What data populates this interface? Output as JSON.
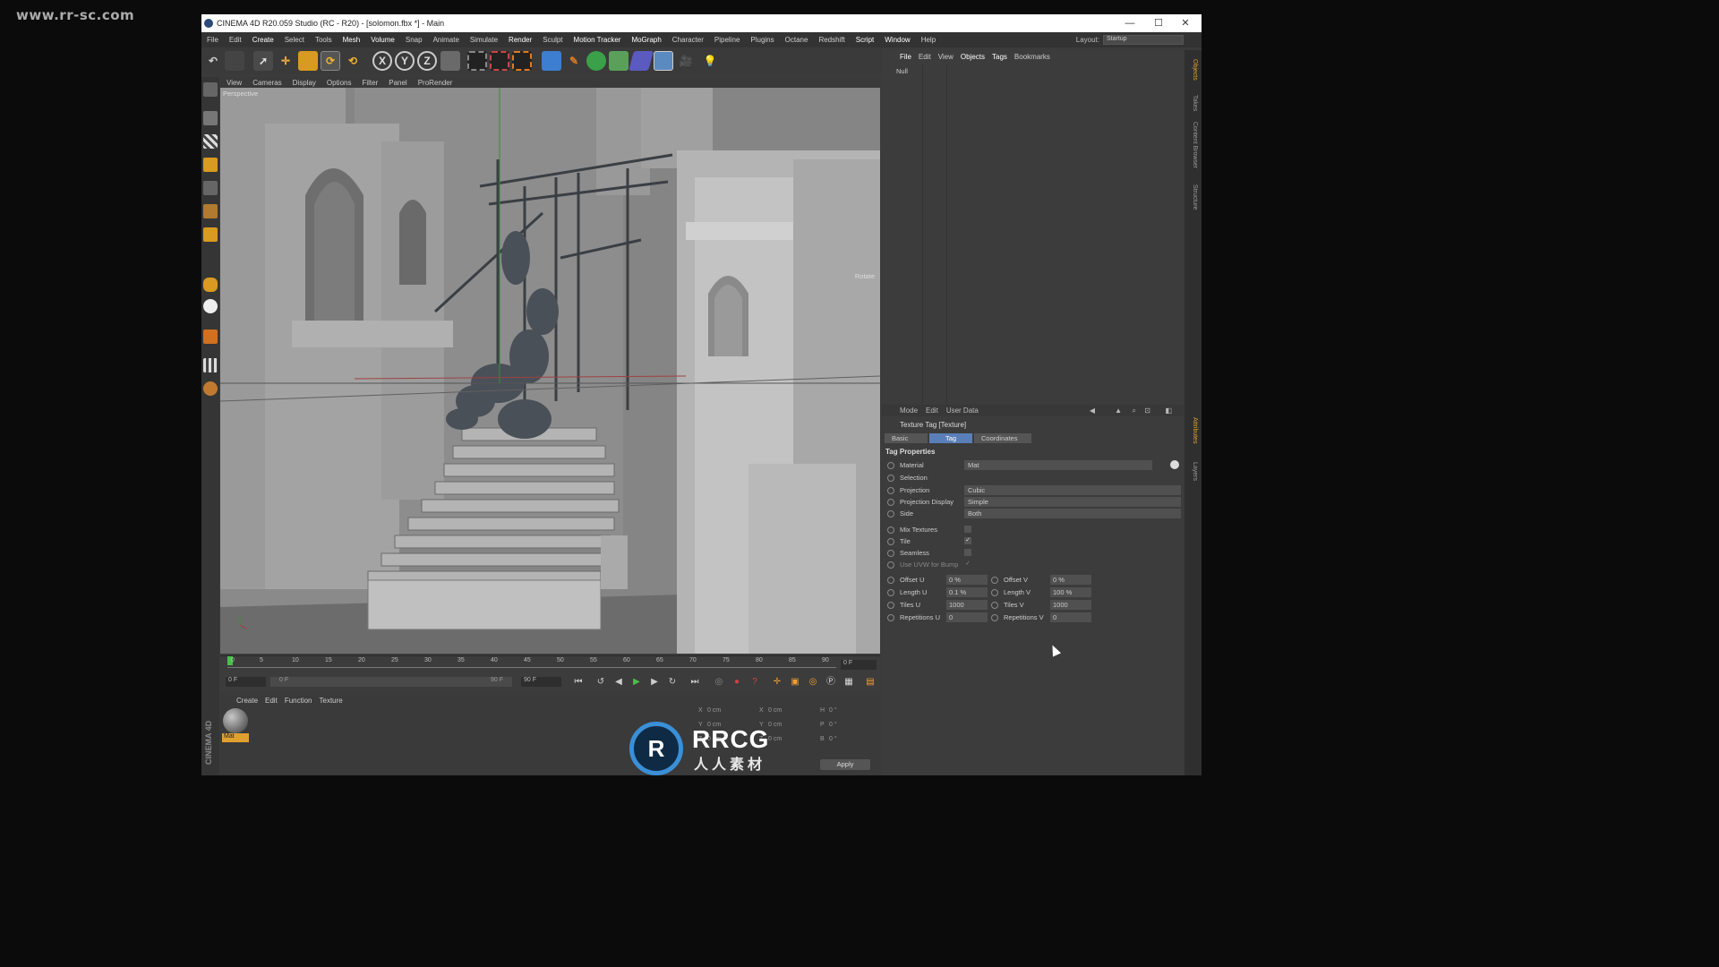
{
  "watermark_top": "www.rr-sc.com",
  "window": {
    "title": "CINEMA 4D R20.059 Studio (RC - R20) - [solomon.fbx *] - Main",
    "minimize": "—",
    "maximize": "☐",
    "close": "✕"
  },
  "menu": [
    "File",
    "Edit",
    "Create",
    "Select",
    "Tools",
    "Mesh",
    "Volume",
    "Snap",
    "Animate",
    "Simulate",
    "Render",
    "Sculpt",
    "Motion Tracker",
    "MoGraph",
    "Character",
    "Pipeline",
    "Plugins",
    "Octane",
    "Redshift",
    "Script",
    "Window",
    "Help"
  ],
  "layout": {
    "label": "Layout:",
    "value": "Startup"
  },
  "toolbar": {
    "x": "X",
    "y": "Y",
    "z": "Z"
  },
  "viewport": {
    "menu": [
      "View",
      "Cameras",
      "Display",
      "Options",
      "Filter",
      "Panel",
      "ProRender"
    ],
    "label": "Perspective",
    "rotate": "Rotate"
  },
  "timeline": {
    "ticks": [
      "0",
      "5",
      "10",
      "15",
      "20",
      "25",
      "30",
      "35",
      "40",
      "45",
      "50",
      "55",
      "60",
      "65",
      "70",
      "75",
      "80",
      "85",
      "90"
    ],
    "frame": "0 F"
  },
  "playbar": {
    "start": "0 F",
    "min": "0 F",
    "max": "90 F",
    "end": "90 F"
  },
  "material_manager": {
    "menu": [
      "Create",
      "Edit",
      "Function",
      "Texture"
    ],
    "material_name": "Mat"
  },
  "brand_vertical": "CINEMA 4D",
  "coords": {
    "rows": [
      {
        "a": "X",
        "av": "0 cm",
        "b": "X",
        "bv": "0 cm",
        "c": "H",
        "cv": "0 °"
      },
      {
        "a": "Y",
        "av": "0 cm",
        "b": "Y",
        "bv": "0 cm",
        "c": "P",
        "cv": "0 °"
      },
      {
        "a": "Z",
        "av": "0 cm",
        "b": "Z",
        "bv": "0 cm",
        "c": "B",
        "cv": "0 °"
      }
    ],
    "apply": "Apply"
  },
  "object_manager": {
    "menu": [
      "File",
      "Edit",
      "View",
      "Objects",
      "Tags",
      "Bookmarks"
    ],
    "object": "Null"
  },
  "attributes": {
    "menu": [
      "Mode",
      "Edit",
      "User Data"
    ],
    "title": "Texture Tag [Texture]",
    "tabs": [
      "Basic",
      "Tag",
      "Coordinates"
    ],
    "section": "Tag Properties",
    "props": [
      {
        "label": "Material",
        "value": "Mat"
      },
      {
        "label": "Selection",
        "value": ""
      },
      {
        "label": "Projection",
        "value": "Cubic"
      },
      {
        "label": "Projection Display",
        "value": "Simple"
      },
      {
        "label": "Side",
        "value": "Both"
      }
    ],
    "checks": [
      {
        "label": "Mix Textures",
        "value": ""
      },
      {
        "label": "Tile",
        "value": "✓"
      },
      {
        "label": "Seamless",
        "value": ""
      },
      {
        "label": "Use UVW for Bump",
        "value": "✓"
      }
    ],
    "numeric": [
      {
        "l1": "Offset U",
        "v1": "0 %",
        "l2": "Offset V",
        "v2": "0 %"
      },
      {
        "l1": "Length U",
        "v1": "0.1 %",
        "l2": "Length V",
        "v2": "100 %"
      },
      {
        "l1": "Tiles U",
        "v1": "1000",
        "l2": "Tiles V",
        "v2": "1000"
      },
      {
        "l1": "Repetitions U",
        "v1": "0",
        "l2": "Repetitions V",
        "v2": "0"
      }
    ]
  },
  "right_strip_tabs": [
    "Objects",
    "Takes",
    "Content Browser",
    "Structure",
    "Attributes",
    "Layers"
  ],
  "overlay_watermark": {
    "logo": "R",
    "brand": "RRCG",
    "sub": "人人素材"
  },
  "colors": {
    "accent_blue": "#5a7fb8",
    "material_orange": "#e0a030",
    "viewport_grey": "#777777"
  }
}
